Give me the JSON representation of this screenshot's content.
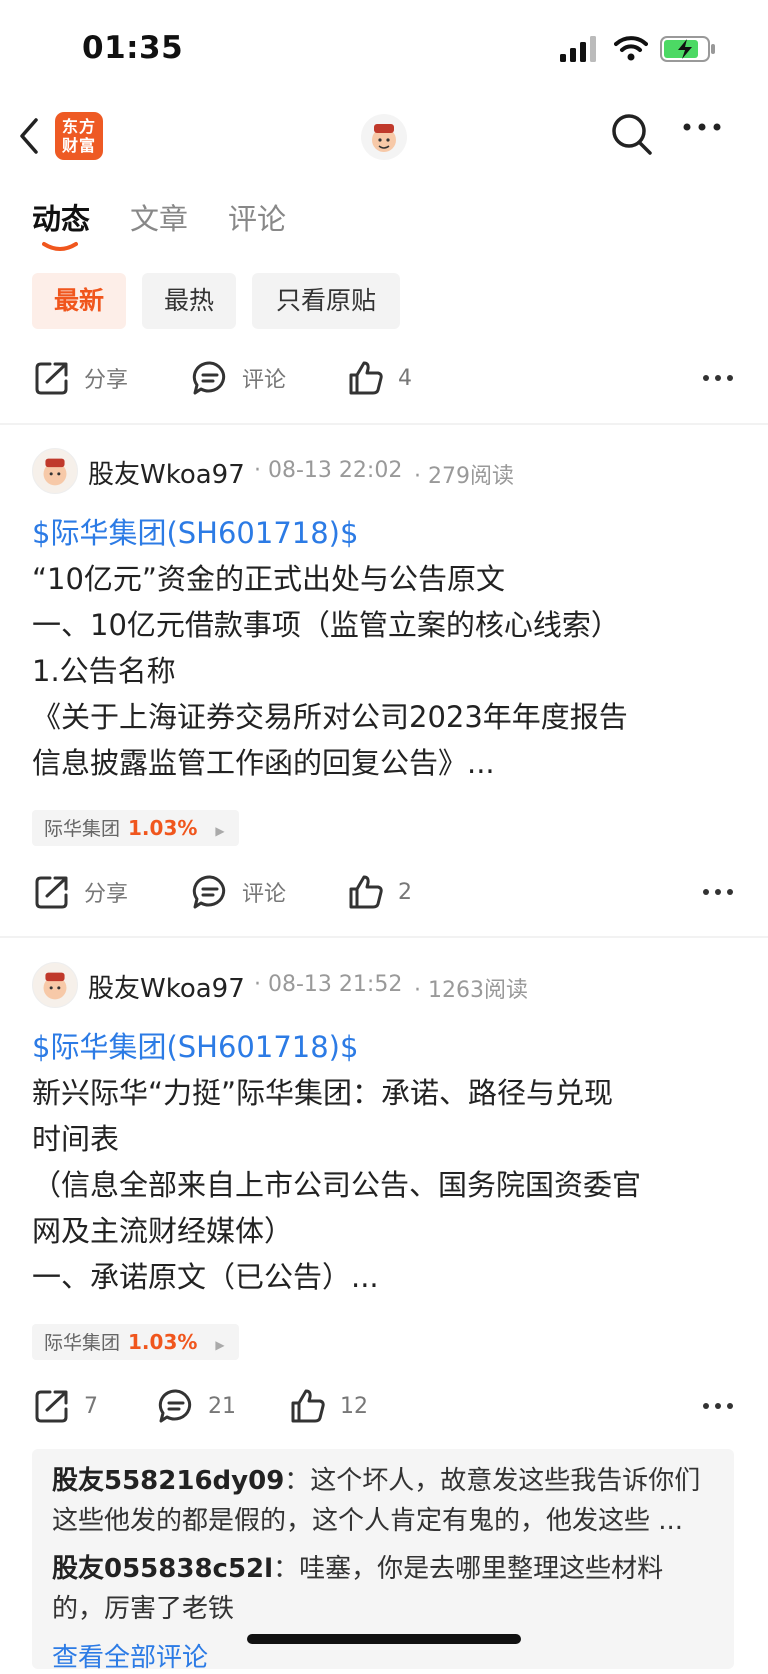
{
  "status": {
    "time": "01:35"
  },
  "nav": {
    "logo_line1": "东方",
    "logo_line2": "财富"
  },
  "tabs": [
    {
      "label": "动态",
      "active": true
    },
    {
      "label": "文章",
      "active": false
    },
    {
      "label": "评论",
      "active": false
    }
  ],
  "filters": [
    "最新",
    "最热",
    "只看原贴"
  ],
  "top_actions": {
    "share": "分享",
    "comment": "评论",
    "like": "4"
  },
  "posts": [
    {
      "author": "股友Wkoa97",
      "date": "08-13 22:02",
      "reads": "279阅读",
      "stock": "$际华集团(SH601718)$",
      "lines": [
        "“10亿元”资金的正式出处与公告原文",
        "一、10亿元借款事项（监管立案的核心线索）",
        "1.公告名称",
        "《关于上海证券交易所对公司2023年年度报告",
        "信息披露监管工作函的回复公告》..."
      ],
      "tag": {
        "name": "际华集团",
        "pct": "1.03%"
      },
      "actions": {
        "share": "分享",
        "comment": "评论",
        "like": "2"
      }
    },
    {
      "author": "股友Wkoa97",
      "date": "08-13 21:52",
      "reads": "1263阅读",
      "stock": "$际华集团(SH601718)$",
      "lines": [
        "新兴际华“力挺”际华集团：承诺、路径与兑现",
        "时间表",
        "（信息全部来自上市公司公告、国务院国资委官",
        "网及主流财经媒体）",
        "一、承诺原文（已公告）..."
      ],
      "tag": {
        "name": "际华集团",
        "pct": "1.03%"
      },
      "actions": {
        "share": "7",
        "comment": "21",
        "like": "12"
      }
    }
  ],
  "comments": [
    {
      "name": "股友558216dy09",
      "text_line1": "：这个坏人，故意发这些我告诉你们",
      "text_line2": "这些他发的都是假的，这个人肯定有鬼的，他发这些 ..."
    },
    {
      "name": "股友055838c52l",
      "text_line1": "：哇塞，你是去哪里整理这些材料",
      "text_line2": "的，厉害了老铁"
    }
  ],
  "view_all": "查看全部评论",
  "colors": {
    "accent": "#f0561d",
    "link": "#2c7be5",
    "logo_bg": "#ee5a24"
  }
}
